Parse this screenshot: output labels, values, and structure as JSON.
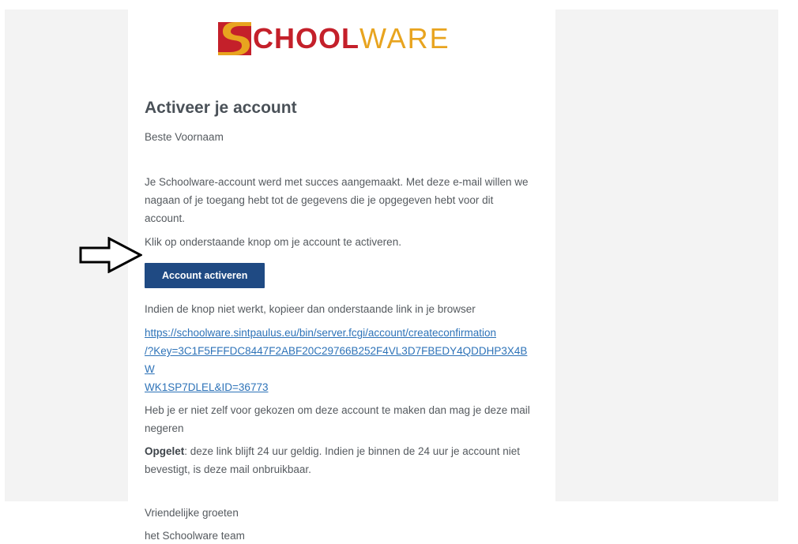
{
  "logo": {
    "text_strong": "CHOOL",
    "text_light": "WARE",
    "brand_color": "#c4202a",
    "accent_color": "#e8a41f"
  },
  "email": {
    "title": "Activeer je account",
    "greeting": "Beste Voornaam",
    "intro": "Je Schoolware-account werd met succes aangemaakt. Met deze e-mail willen we nagaan of je toegang hebt tot de gegevens die je opgegeven hebt voor dit account.",
    "instruction": "Klik op onderstaande knop om je account te activeren.",
    "button_label": "Account activeren",
    "button_color": "#1f4a83",
    "fallback_text": "Indien de knop niet werkt, kopieer dan onderstaande link in je browser",
    "link_line1": "https://schoolware.sintpaulus.eu/bin/server.fcgi/account/createconfirmation",
    "link_line2": "/?Key=3C1F5FFFDC8447F2ABF20C29766B252F4VL3D7FBEDY4QDDHP3X4BW",
    "link_line3": "WK1SP7DLEL&ID=36773",
    "ignore_text": "Heb je er niet zelf voor gekozen om deze account te maken dan mag je deze mail negeren",
    "warning_label": "Opgelet",
    "warning_text": ": deze link blijft 24 uur geldig. Indien je binnen de 24 uur je account niet bevestigt, is deze mail onbruikbaar.",
    "closing": "Vriendelijke groeten",
    "signature": "het Schoolware team"
  },
  "icons": {
    "logo_mark": "schoolware-s-mark-icon",
    "pointer": "right-arrow-icon"
  }
}
